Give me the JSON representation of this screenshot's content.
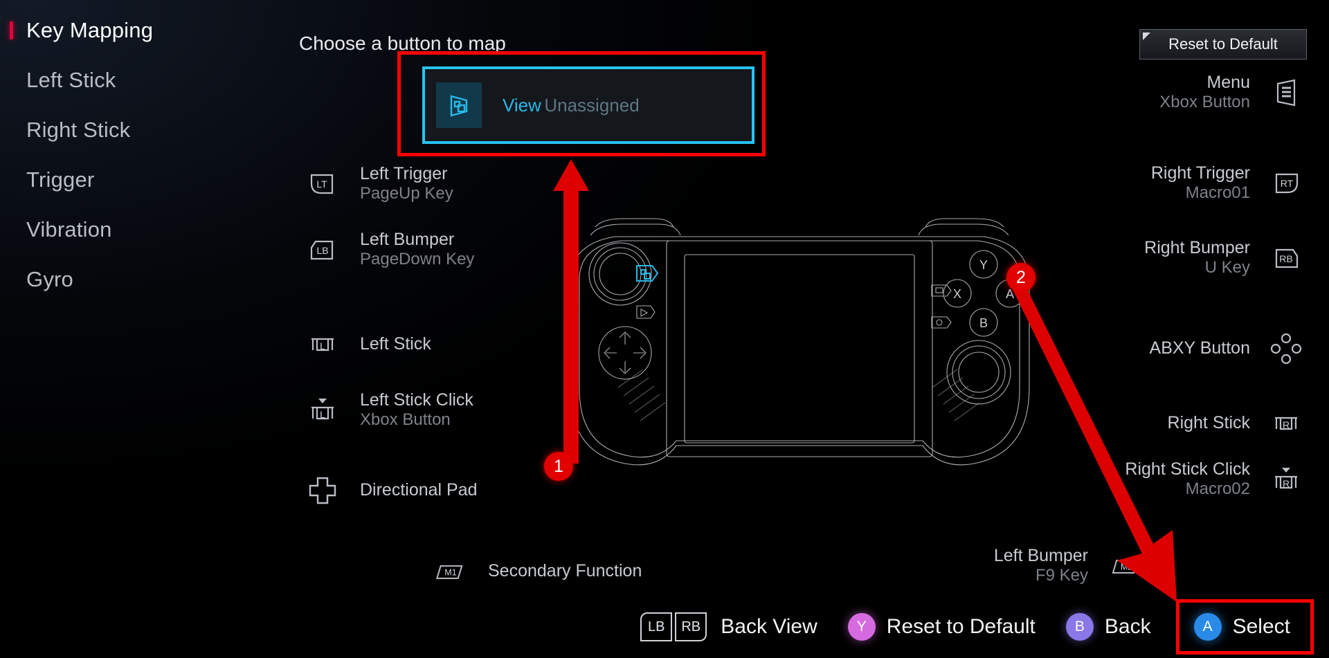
{
  "sidebar": {
    "items": [
      {
        "label": "Key Mapping",
        "active": true
      },
      {
        "label": "Left Stick",
        "active": false
      },
      {
        "label": "Right Stick",
        "active": false
      },
      {
        "label": "Trigger",
        "active": false
      },
      {
        "label": "Vibration",
        "active": false
      },
      {
        "label": "Gyro",
        "active": false
      }
    ]
  },
  "header": {
    "title": "Choose a button to map",
    "reset_button": "Reset to Default"
  },
  "selected_card": {
    "title": "View",
    "subtitle": "Unassigned",
    "icon": "view-window-icon",
    "highlight_color": "#27c3f3",
    "annotation_color": "#ff0000"
  },
  "left_column": [
    {
      "icon": "lt-trigger-icon",
      "title": "Left Trigger",
      "subtitle": "PageUp Key"
    },
    {
      "icon": "lb-bumper-icon",
      "title": "Left Bumper",
      "subtitle": "PageDown Key"
    },
    {
      "icon": "left-stick-icon",
      "title": "Left Stick",
      "subtitle": ""
    },
    {
      "icon": "left-stick-click-icon",
      "title": "Left Stick Click",
      "subtitle": "Xbox Button"
    },
    {
      "icon": "dpad-icon",
      "title": "Directional Pad",
      "subtitle": ""
    }
  ],
  "right_column": [
    {
      "icon": "menu-icon",
      "title": "Menu",
      "subtitle": "Xbox Button"
    },
    {
      "icon": "rt-trigger-icon",
      "title": "Right Trigger",
      "subtitle": "Macro01"
    },
    {
      "icon": "rb-bumper-icon",
      "title": "Right Bumper",
      "subtitle": "U Key"
    },
    {
      "icon": "abxy-icon",
      "title": "ABXY Button",
      "subtitle": ""
    },
    {
      "icon": "right-stick-icon",
      "title": "Right Stick",
      "subtitle": ""
    },
    {
      "icon": "right-stick-click-icon",
      "title": "Right Stick Click",
      "subtitle": "Macro02"
    }
  ],
  "macro_rows": {
    "m1": {
      "icon": "m1-icon",
      "title": "Secondary Function",
      "subtitle": ""
    },
    "m2": {
      "icon": "m2-icon",
      "title": "Left Bumper",
      "subtitle": "F9 Key"
    }
  },
  "annotations": [
    {
      "number": "1",
      "color": "#e20000"
    },
    {
      "number": "2",
      "color": "#e20000"
    }
  ],
  "bottom_bar": {
    "back_view": {
      "keys": [
        "LB",
        "RB"
      ],
      "label": "Back View"
    },
    "reset": {
      "button": "Y",
      "label": "Reset to Default",
      "color": "#d66be0"
    },
    "back": {
      "button": "B",
      "label": "Back",
      "color": "#8a77e8"
    },
    "select": {
      "button": "A",
      "label": "Select",
      "color": "#2a8ae8",
      "highlighted": true
    }
  }
}
